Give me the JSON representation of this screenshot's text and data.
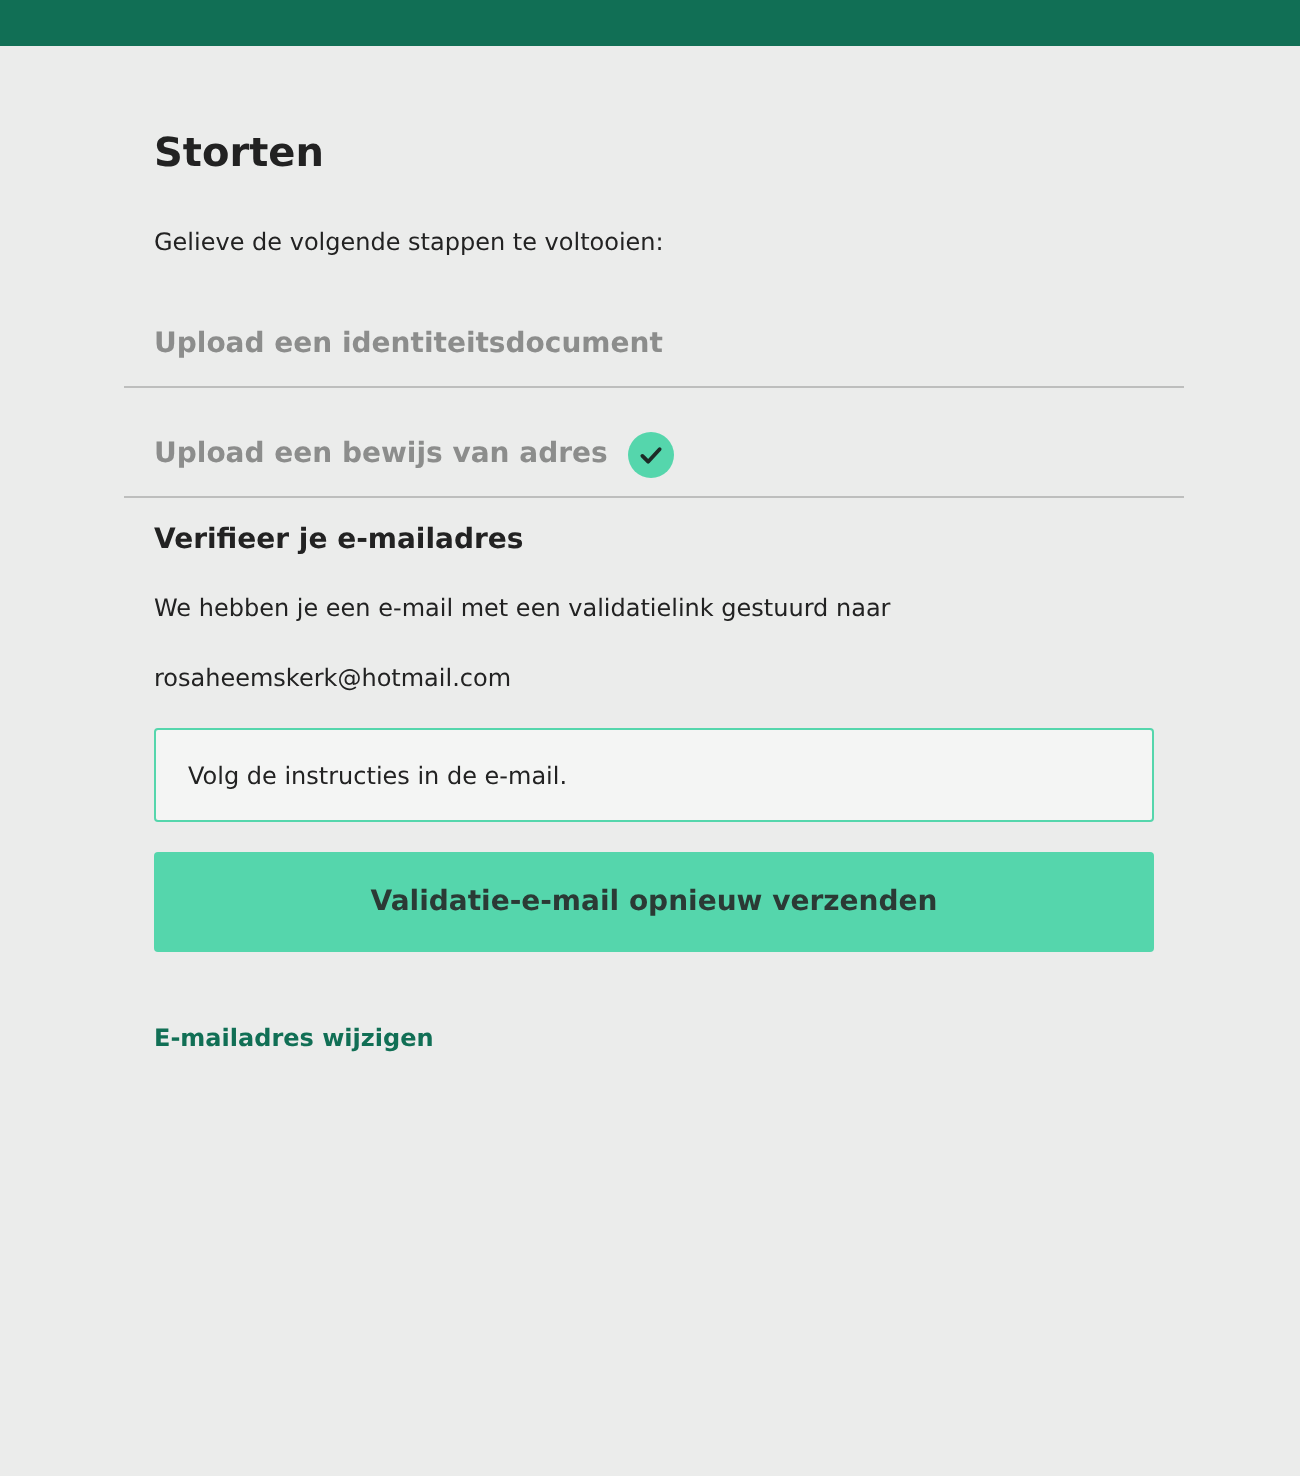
{
  "title": "Storten",
  "intro": "Gelieve de volgende stappen te voltooien:",
  "steps": [
    {
      "label": "Upload een identiteitsdocument",
      "completed": false
    },
    {
      "label": "Upload een bewijs van adres",
      "completed": true
    }
  ],
  "verify": {
    "heading": "Verifieer je e-mailadres",
    "text": "We hebben je een e-mail met een validatielink gestuurd naar",
    "email": "rosaheemskerk@hotmail.com",
    "notice": "Volg de instructies in de e-mail.",
    "button": "Validatie-e-mail opnieuw verzenden",
    "link": "E-mailadres wijzigen"
  }
}
